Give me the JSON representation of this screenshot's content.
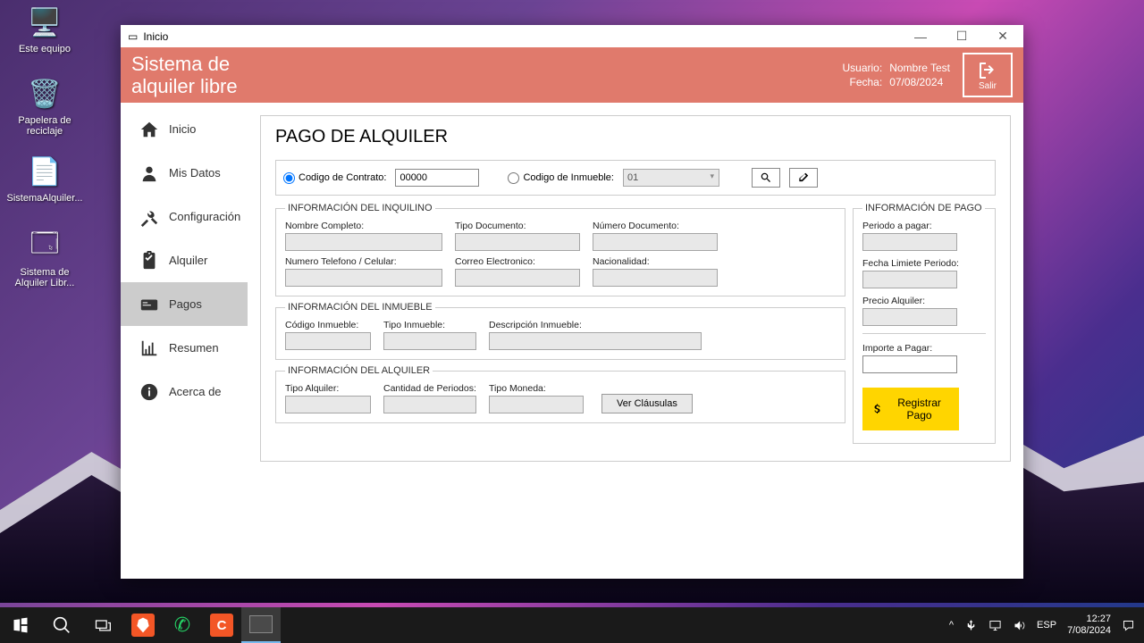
{
  "desktop": {
    "icons": [
      {
        "label": "Este equipo",
        "glyph": "🖥️"
      },
      {
        "label": "Papelera de reciclaje",
        "glyph": "🗑️"
      },
      {
        "label": "SistemaAlquiler...",
        "glyph": "📄"
      },
      {
        "label": "Sistema de Alquiler Libr...",
        "glyph": "🗔"
      }
    ]
  },
  "window": {
    "title": "Inicio",
    "ctrl": {
      "min": "—",
      "max": "☐",
      "close": "✕"
    }
  },
  "header": {
    "appname_l1": "Sistema de",
    "appname_l2": "alquiler libre",
    "user_lbl": "Usuario:",
    "user_val": "Nombre Test",
    "date_lbl": "Fecha:",
    "date_val": "07/08/2024",
    "exit": "Salir"
  },
  "nav": {
    "inicio": "Inicio",
    "misdatos": "Mis Datos",
    "config": "Configuración",
    "alquiler": "Alquiler",
    "pagos": "Pagos",
    "resumen": "Resumen",
    "acerca": "Acerca de"
  },
  "page": {
    "title": "PAGO DE ALQUILER",
    "search": {
      "r1": "Codigo de Contrato:",
      "r1_val": "00000",
      "r2": "Codigo de Inmueble:",
      "r2_val": "01"
    },
    "inquilino": {
      "legend": "INFORMACIÓN DEL INQUILINO",
      "nombre": "Nombre Completo:",
      "tipodoc": "Tipo Documento:",
      "numdoc": "Número Documento:",
      "telefono": "Numero Telefono / Celular:",
      "correo": "Correo Electronico:",
      "nacion": "Nacionalidad:"
    },
    "inmueble": {
      "legend": "INFORMACIÓN DEL INMUEBLE",
      "codigo": "Código Inmueble:",
      "tipo": "Tipo Inmueble:",
      "desc": "Descripción Inmueble:"
    },
    "alquiler": {
      "legend": "INFORMACIÓN DEL ALQUILER",
      "tipo": "Tipo Alquiler:",
      "cant": "Cantidad de Periodos:",
      "moneda": "Tipo Moneda:",
      "clausulas": "Ver Cláusulas"
    },
    "pago": {
      "legend": "INFORMACIÓN DE PAGO",
      "periodo": "Periodo a pagar:",
      "fechalim": "Fecha Limiete Periodo:",
      "precio": "Precio Alquiler:",
      "importe": "Importe a Pagar:",
      "registrar": "Registrar Pago"
    }
  },
  "taskbar": {
    "lang": "ESP",
    "time": "12:27",
    "date": "7/08/2024"
  }
}
